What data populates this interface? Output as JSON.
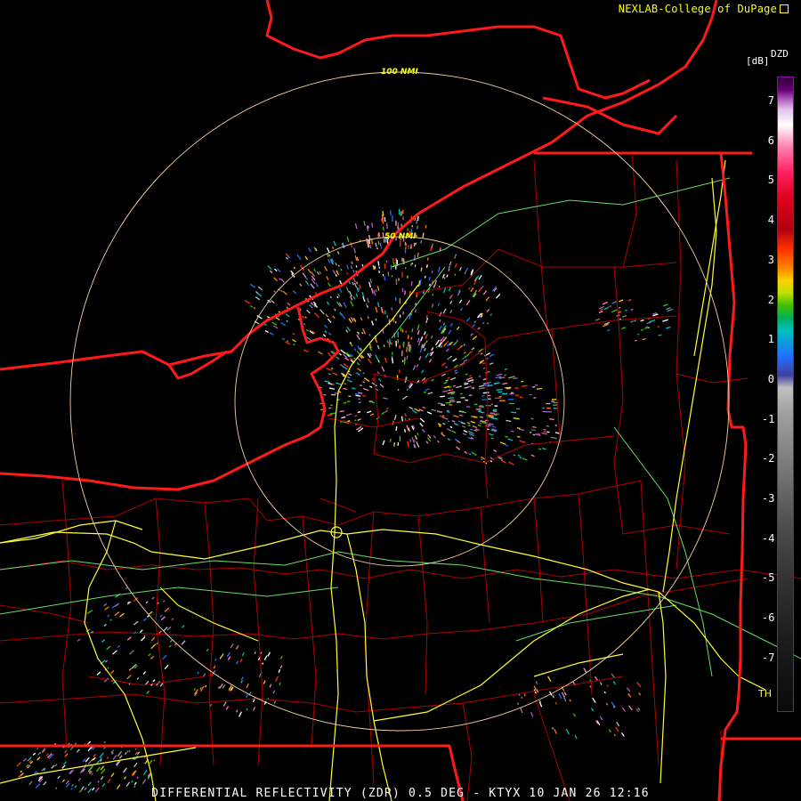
{
  "credit": "NEXLAB-College of DuPage",
  "legend": {
    "product": "DZD",
    "units": "[dB]",
    "ticks": [
      "7",
      "6",
      "5",
      "4",
      "3",
      "2",
      "1",
      "0",
      "-1",
      "-2",
      "-3",
      "-4",
      "-5",
      "-6",
      "-7"
    ],
    "threshold_label": "TH"
  },
  "range_rings": {
    "outer": "100 NMI",
    "inner": "50 NMI"
  },
  "caption": "DIFFERENTIAL REFLECTIVITY (ZDR) 0.5 DEG - KTYX 10 JAN 26 12:16",
  "colors": {
    "state_border": "#ff1a1a",
    "county_line": "#c00000",
    "highway": "#ffff33",
    "road": "#66dd66",
    "range_ring": "#f0d0a0",
    "label": "#ffff00"
  }
}
